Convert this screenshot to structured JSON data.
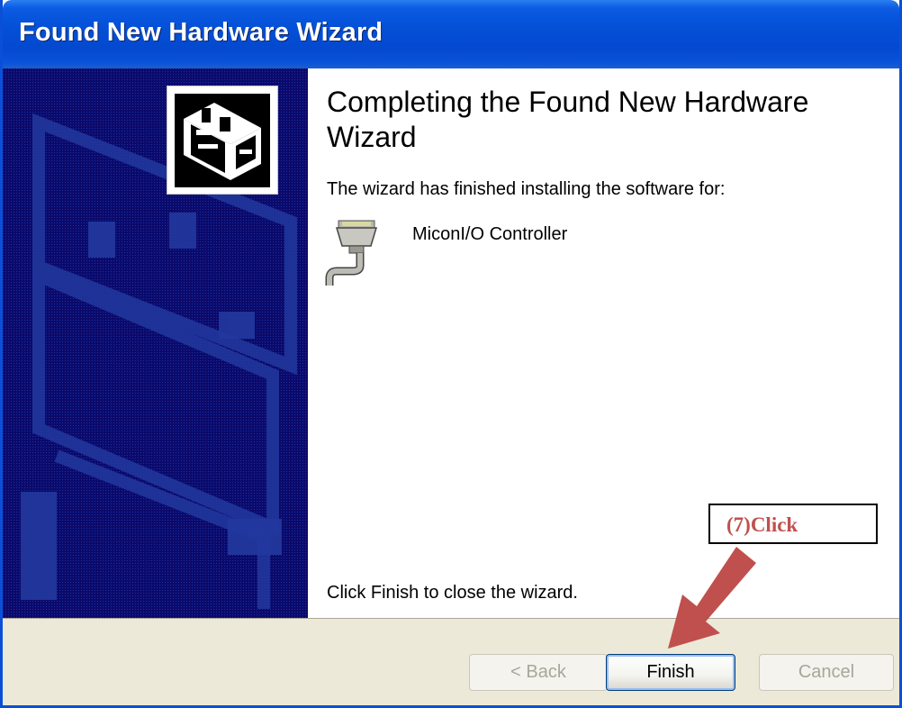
{
  "window": {
    "title": "Found New Hardware Wizard"
  },
  "content": {
    "heading": "Completing the Found New Hardware Wizard",
    "intro": "The wizard has finished installing the software for:",
    "device_name": "MiconI/O Controller",
    "footer": "Click Finish to close the wizard."
  },
  "buttons": {
    "back": "< Back",
    "finish": "Finish",
    "cancel": "Cancel"
  },
  "annotation": {
    "label": "(7)Click",
    "color": "#c0504d"
  },
  "icons": {
    "wizard": "hardware-box-icon",
    "device": "serial-port-cable-icon"
  },
  "colors": {
    "title_bar": "#0450d6",
    "sidebar": "#0b0a6b",
    "button_bar": "#ece9d8",
    "arrow": "#c0504d"
  }
}
